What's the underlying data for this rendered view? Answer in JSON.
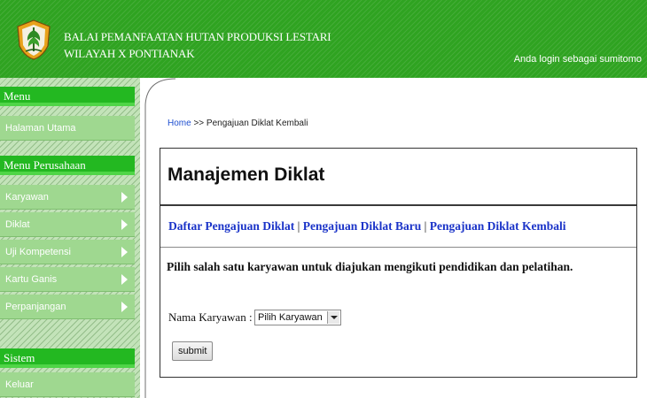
{
  "header": {
    "org_line1": "BALAI PEMANFAATAN HUTAN PRODUKSI LESTARI",
    "org_line2": "WILAYAH X PONTIANAK",
    "login_text": "Anda login sebagai sumitomo"
  },
  "sidebar": {
    "menu_title": "Menu",
    "home_item": "Halaman Utama",
    "company_title": "Menu Perusahaan",
    "company_items": [
      {
        "label": "Karyawan",
        "icon": "chevron-right-icon"
      },
      {
        "label": "Diklat",
        "icon": "chevron-right-icon"
      },
      {
        "label": "Uji Kompetensi",
        "icon": "chevron-right-icon"
      },
      {
        "label": "Kartu Ganis",
        "icon": "chevron-right-icon"
      },
      {
        "label": "Perpanjangan",
        "icon": "chevron-right-icon"
      }
    ],
    "system_title": "Sistem",
    "logout_item": "Keluar"
  },
  "breadcrumb": {
    "home": "Home",
    "rest": ">> Pengajuan Diklat Kembali"
  },
  "main": {
    "title": "Manajemen Diklat",
    "links": [
      "Daftar Pengajuan Diklat",
      "Pengajuan Diklat Baru",
      "Pengajuan Diklat Kembali"
    ],
    "separator": "|",
    "instruction": "Pilih salah satu karyawan untuk diajukan mengikuti pendidikan dan pelatihan.",
    "field_label": "Nama Karyawan :",
    "select_value": "Pilih Karyawan",
    "submit_label": "submit"
  },
  "colors": {
    "header_green": "#2fa321",
    "menu_head": "#23b821",
    "menu_item": "#9fd890",
    "link_blue": "#1a33c8"
  }
}
